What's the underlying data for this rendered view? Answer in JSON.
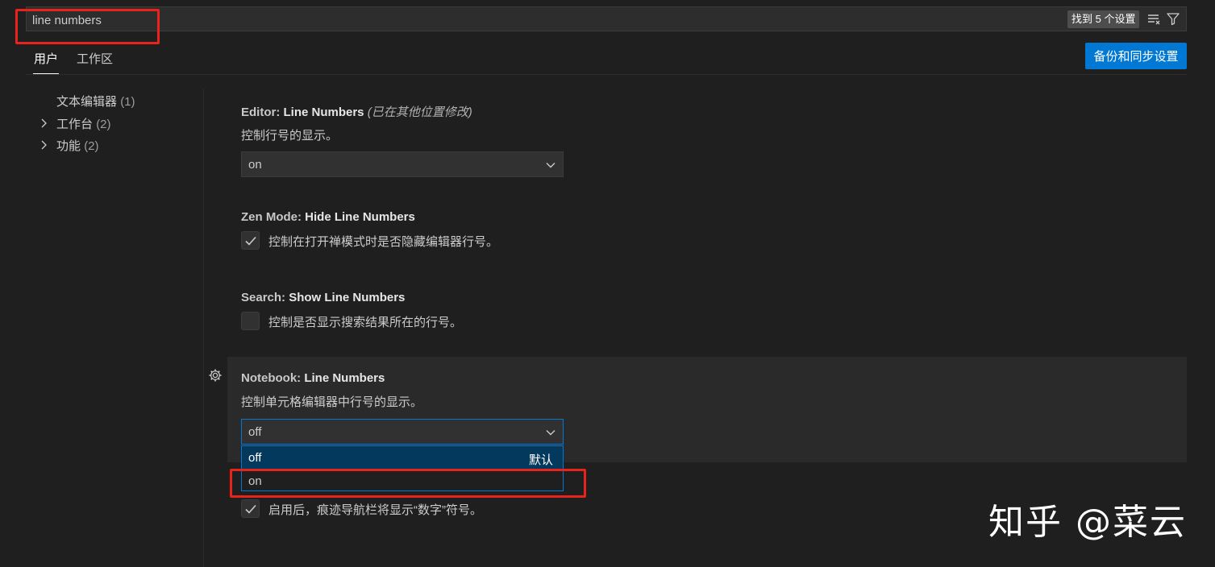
{
  "search": {
    "value": "line numbers",
    "found_label": "找到 5 个设置"
  },
  "tabs": [
    {
      "label": "用户",
      "active": true
    },
    {
      "label": "工作区",
      "active": false
    }
  ],
  "sync_button_label": "备份和同步设置",
  "toc": [
    {
      "label": "文本编辑器",
      "count": "(1)",
      "expandable": false
    },
    {
      "label": "工作台",
      "count": "(2)",
      "expandable": true
    },
    {
      "label": "功能",
      "count": "(2)",
      "expandable": true
    }
  ],
  "settings": {
    "editor_line_numbers": {
      "category": "Editor: ",
      "name": "Line Numbers",
      "modified_note": "(已在其他位置修改)",
      "description": "控制行号的显示。",
      "value": "on"
    },
    "zen_mode": {
      "category": "Zen Mode: ",
      "name": "Hide Line Numbers",
      "description": "控制在打开禅模式时是否隐藏编辑器行号。",
      "checked": true
    },
    "search_line_numbers": {
      "category": "Search: ",
      "name": "Show Line Numbers",
      "description": "控制是否显示搜索结果所在的行号。",
      "checked": false
    },
    "notebook_line_numbers": {
      "category": "Notebook: ",
      "name": "Line Numbers",
      "description": "控制单元格编辑器中行号的显示。",
      "value": "off",
      "options": [
        {
          "label": "off",
          "note": "默认"
        },
        {
          "label": "on",
          "note": ""
        }
      ]
    },
    "breadcrumbs_numbers": {
      "description": "启用后，痕迹导航栏将显示“数字”符号。",
      "checked": true
    }
  },
  "watermark": "知乎 @菜云",
  "colors": {
    "accent": "#0078d4",
    "annotation": "#e8231c",
    "background": "#1f1f1f"
  }
}
